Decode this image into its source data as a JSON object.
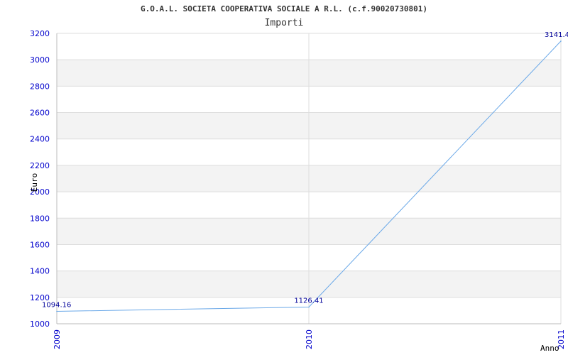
{
  "chart_data": {
    "type": "line",
    "title": "G.O.A.L. SOCIETA COOPERATIVA SOCIALE A R.L. (c.f.90020730801)",
    "subtitle": "Importi",
    "xlabel": "Anno",
    "ylabel": "Euro",
    "categories": [
      "2009",
      "2010",
      "2011"
    ],
    "series": [
      {
        "values": [
          1094.16,
          1126.41,
          3141.4
        ],
        "labels": [
          "1094.16",
          "1126.41",
          "3141.4"
        ],
        "color": "#6aa8e8"
      }
    ],
    "ylim": [
      1000,
      3200
    ],
    "yticks": [
      1000,
      1200,
      1400,
      1600,
      1800,
      2000,
      2200,
      2400,
      2600,
      2800,
      3000,
      3200
    ],
    "grid": true,
    "band_color": "#f3f3f3",
    "grid_color": "#dddddd",
    "tick_color": "#0000cc"
  }
}
